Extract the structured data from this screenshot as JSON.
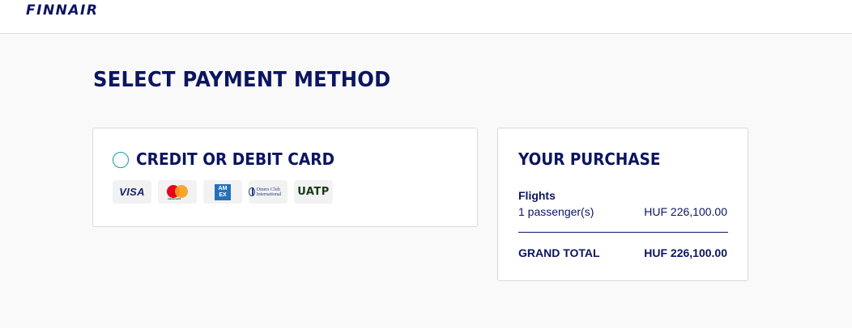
{
  "header": {
    "brand": "FINNAIR"
  },
  "page": {
    "title": "SELECT PAYMENT METHOD"
  },
  "payment": {
    "option_label": "CREDIT OR DEBIT CARD",
    "option_selected": false,
    "card_brands": [
      {
        "name": "visa",
        "label": "VISA"
      },
      {
        "name": "mastercard",
        "label": "mastercard"
      },
      {
        "name": "amex",
        "label": "AM EX"
      },
      {
        "name": "diners",
        "label": "Diners Club International"
      },
      {
        "name": "uatp",
        "label": "UATP"
      }
    ]
  },
  "purchase": {
    "title": "YOUR PURCHASE",
    "flights_label": "Flights",
    "passengers": "1 passenger(s)",
    "flights_price": "HUF 226,100.00",
    "grand_total_label": "GRAND TOTAL",
    "grand_total_value": "HUF 226,100.00"
  },
  "colors": {
    "brand_navy": "#0b1560",
    "radio_teal": "#129aa0",
    "page_bg": "#f9f9f9"
  }
}
